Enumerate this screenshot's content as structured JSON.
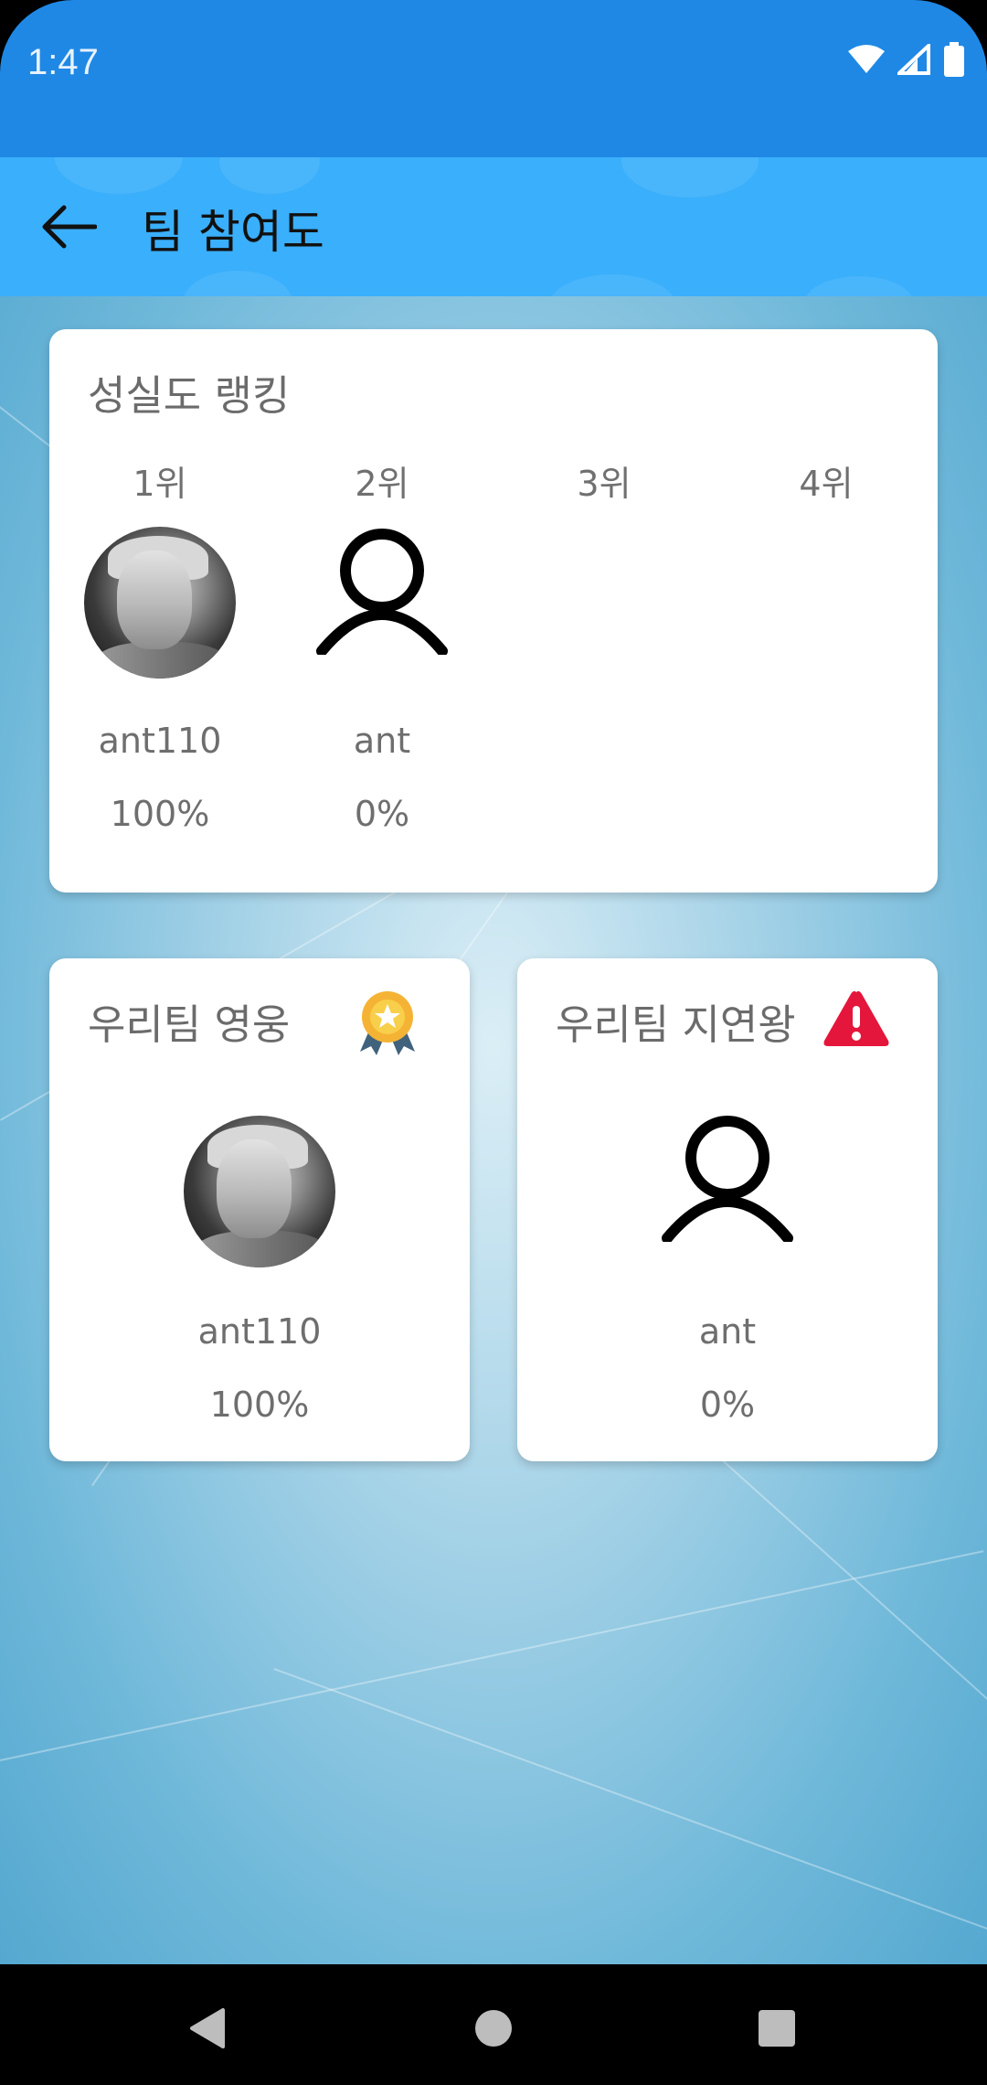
{
  "status_bar": {
    "time": "1:47",
    "icons": [
      "wifi-icon",
      "signal-icon",
      "battery-icon"
    ]
  },
  "app_bar": {
    "back_icon": "arrow-left-icon",
    "title": "팀 참여도"
  },
  "ranking_card": {
    "title": "성실도 랭킹",
    "ranks": [
      {
        "label": "1위",
        "name": "ant110",
        "percent": "100%",
        "avatar": "photo"
      },
      {
        "label": "2위",
        "name": "ant",
        "percent": "0%",
        "avatar": "person-icon"
      },
      {
        "label": "3위"
      },
      {
        "label": "4위"
      }
    ]
  },
  "hero_card": {
    "title": "우리팀 영웅",
    "icon": "medal-icon",
    "name": "ant110",
    "percent": "100%"
  },
  "late_card": {
    "title": "우리팀 지연왕",
    "icon": "warning-icon",
    "name": "ant",
    "percent": "0%"
  },
  "nav_bar": {
    "buttons": [
      "back-triangle-icon",
      "home-circle-icon",
      "recents-square-icon"
    ]
  },
  "colors": {
    "status_bar": "#1f88e5",
    "app_bar": "#3aaffb",
    "card": "#ffffff",
    "text_gray": "#6e6e6e",
    "warning_red": "#e5163b",
    "medal_gold": "#f5b335"
  }
}
